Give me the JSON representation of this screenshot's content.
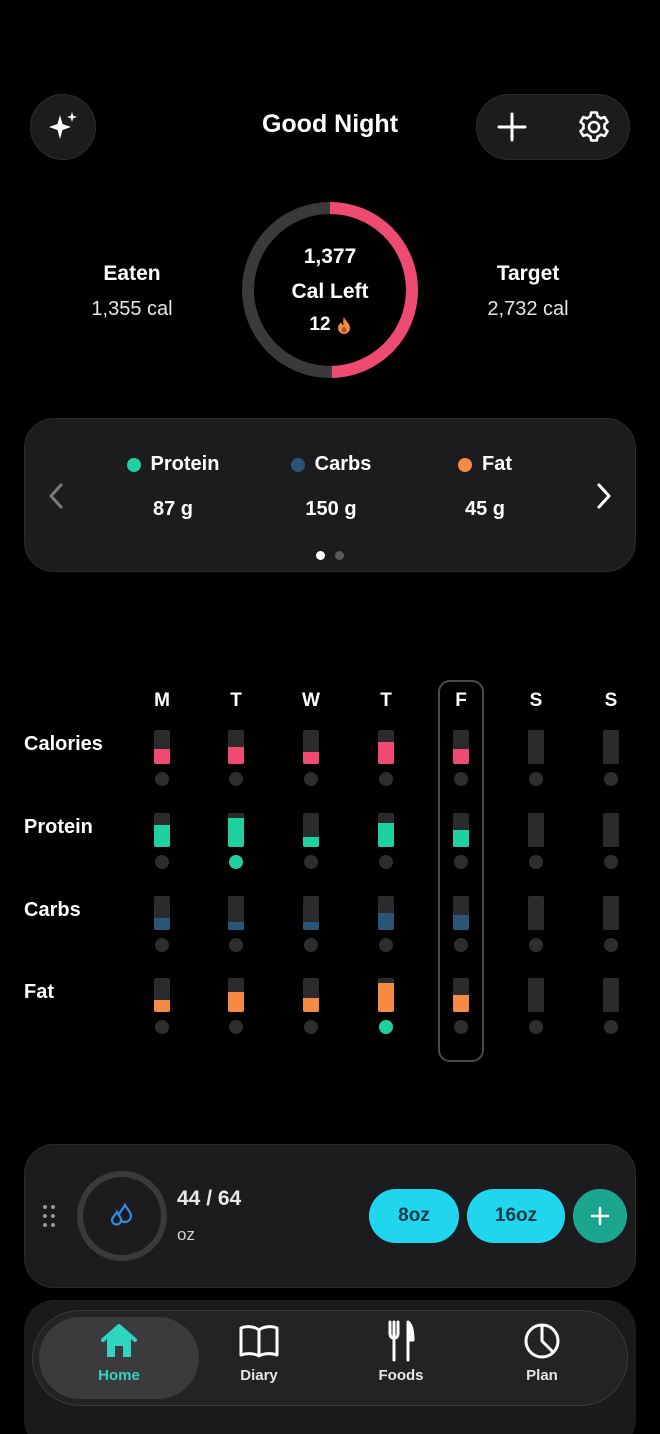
{
  "header": {
    "title": "Good Night"
  },
  "summary": {
    "eaten_label": "Eaten",
    "eaten_value": "1,355 cal",
    "target_label": "Target",
    "target_value": "2,732 cal",
    "cal_left": "1,377",
    "cal_left_label": "Cal Left",
    "streak": "12",
    "ring_progress": 0.496,
    "ring_color": "#ee4a72"
  },
  "macros": [
    {
      "name": "Protein",
      "value": "87 g",
      "color": "#1fd0a0"
    },
    {
      "name": "Carbs",
      "value": "150 g",
      "color": "#2b5577"
    },
    {
      "name": "Fat",
      "value": "45 g",
      "color": "#f58a42"
    }
  ],
  "pager": {
    "pages": 2,
    "active": 0
  },
  "week": {
    "days": [
      "M",
      "T",
      "W",
      "T",
      "F",
      "S",
      "S"
    ],
    "today_index": 4,
    "rows": [
      {
        "label": "Calories",
        "color": "#ee4a72",
        "fills": [
          0.45,
          0.5,
          0.35,
          0.65,
          0.45,
          0,
          0
        ],
        "met": [
          false,
          false,
          false,
          false,
          false,
          false,
          false
        ]
      },
      {
        "label": "Protein",
        "color": "#1fd0a0",
        "fills": [
          0.65,
          0.85,
          0.3,
          0.7,
          0.5,
          0,
          0
        ],
        "met": [
          false,
          true,
          false,
          false,
          false,
          false,
          false
        ]
      },
      {
        "label": "Carbs",
        "color": "#2b5577",
        "fills": [
          0.35,
          0.25,
          0.25,
          0.5,
          0.45,
          0,
          0
        ],
        "met": [
          false,
          false,
          false,
          false,
          false,
          false,
          false
        ]
      },
      {
        "label": "Fat",
        "color": "#f58a42",
        "fills": [
          0.35,
          0.6,
          0.4,
          0.85,
          0.5,
          0,
          0
        ],
        "met": [
          false,
          false,
          false,
          true,
          false,
          false,
          false
        ]
      }
    ],
    "met_color": "#1fd0a0"
  },
  "water": {
    "amount": "44 / 64",
    "unit": "oz",
    "btn_small": "8oz",
    "btn_large": "16oz"
  },
  "tabs": [
    {
      "label": "Home",
      "icon": "home-icon",
      "active": true
    },
    {
      "label": "Diary",
      "icon": "book-icon",
      "active": false
    },
    {
      "label": "Foods",
      "icon": "fork-knife-icon",
      "active": false
    },
    {
      "label": "Plan",
      "icon": "pie-chart-icon",
      "active": false
    }
  ]
}
